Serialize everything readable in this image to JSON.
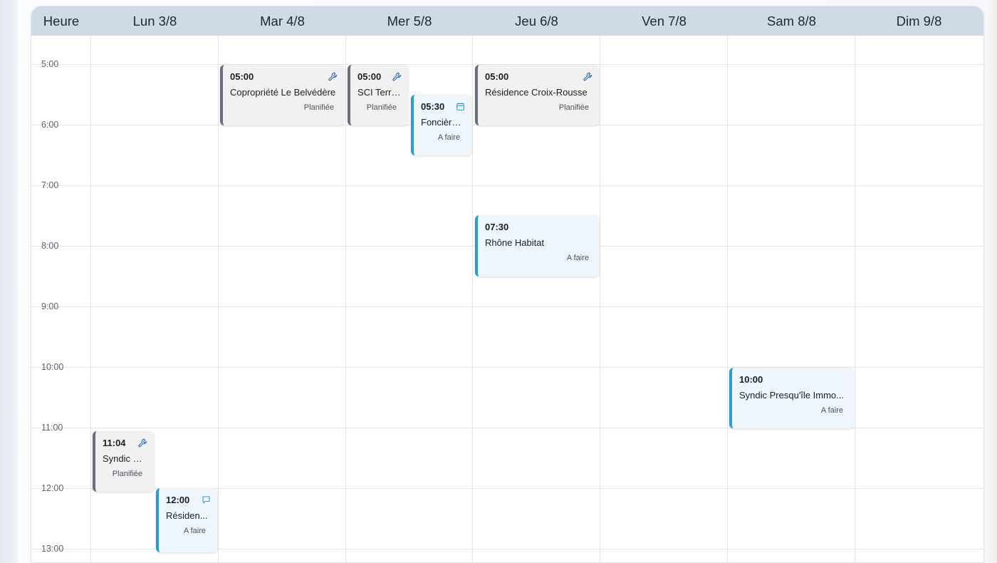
{
  "header": {
    "time_col": "Heure",
    "days": [
      "Lun 3/8",
      "Mar 4/8",
      "Mer 5/8",
      "Jeu 6/8",
      "Ven 7/8",
      "Sam 8/8",
      "Dim 9/8"
    ]
  },
  "time_slots": [
    "5:00",
    "6:00",
    "7:00",
    "8:00",
    "9:00",
    "10:00",
    "11:00",
    "12:00",
    "13:00"
  ],
  "events": [
    {
      "time": "05:00",
      "title": "Copropriété Le Belvédère",
      "status": "Planifiée",
      "kind": "planned",
      "icon": "wrench-icon"
    },
    {
      "time": "05:00",
      "title": "SCI Terre...",
      "status": "Planifiée",
      "kind": "planned",
      "icon": "wrench-icon"
    },
    {
      "time": "05:30",
      "title": "Foncière...",
      "status": "A faire",
      "kind": "todo",
      "icon": "calendar-icon"
    },
    {
      "time": "05:00",
      "title": "Résidence Croix-Rousse",
      "status": "Planifiée",
      "kind": "planned",
      "icon": "wrench-icon"
    },
    {
      "time": "07:30",
      "title": "Rhône Habitat",
      "status": "A faire",
      "kind": "todo",
      "icon": ""
    },
    {
      "time": "10:00",
      "title": "Syndic Presqu'île Immo...",
      "status": "A faire",
      "kind": "todo",
      "icon": ""
    },
    {
      "time": "11:04",
      "title": "Syndic B...",
      "status": "Planifiée",
      "kind": "planned",
      "icon": "wrench-icon"
    },
    {
      "time": "12:00",
      "title": "Résiden...",
      "status": "A faire",
      "kind": "todo",
      "icon": "chat-icon"
    }
  ],
  "colors": {
    "planned_accent": "#6b6f7b",
    "todo_accent": "#2d9bd3",
    "header_bg": "#cfdae7",
    "icon_blue": "#3a6fb0"
  }
}
